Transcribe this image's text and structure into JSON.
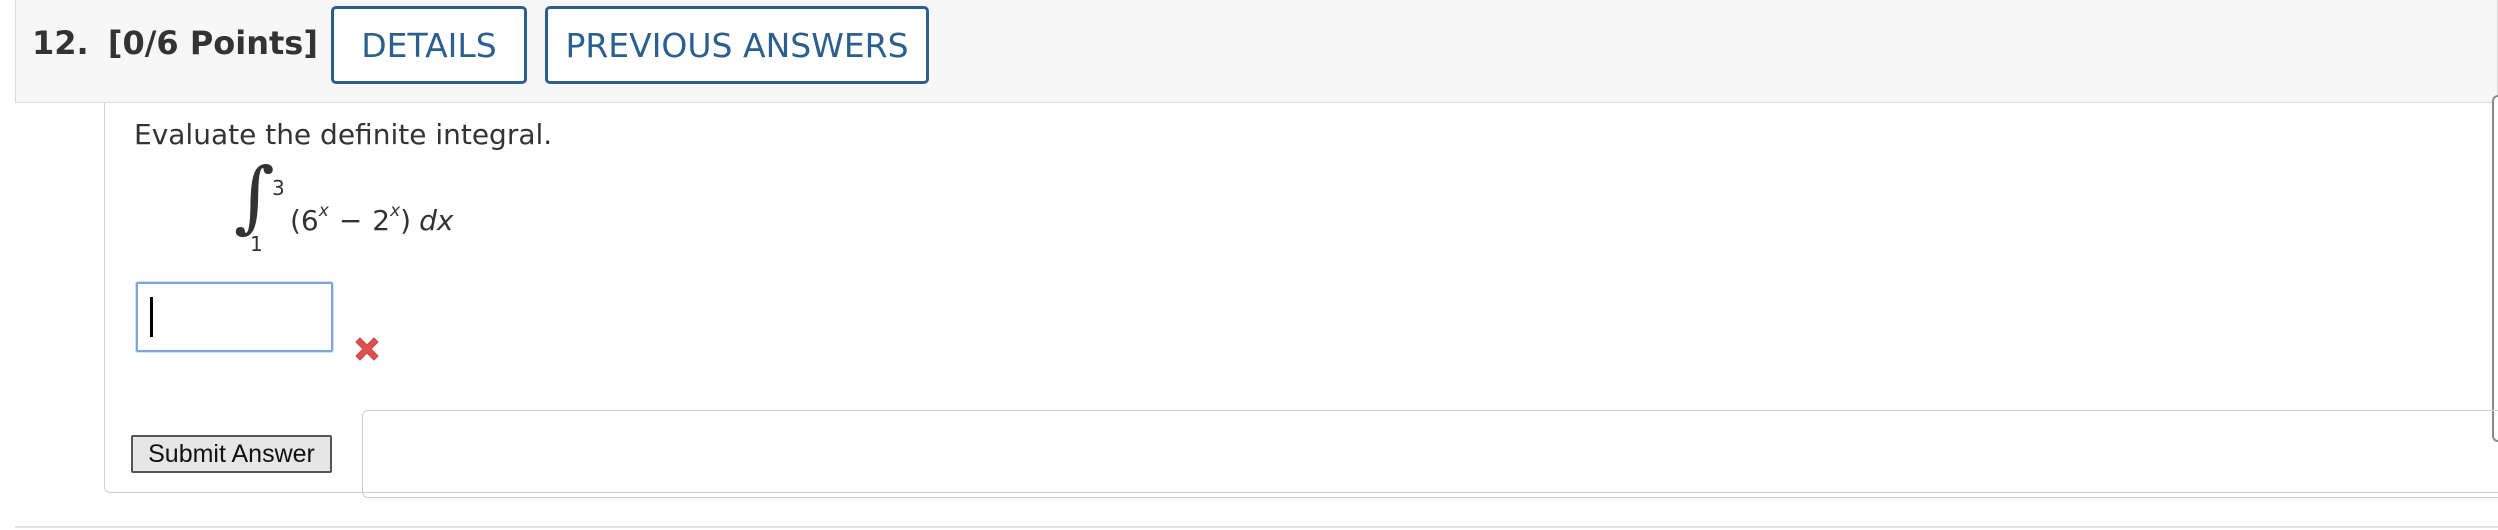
{
  "question": {
    "number_label": "12.",
    "points_label": "[0/6 Points]"
  },
  "header_buttons": {
    "details_label": "DETAILS",
    "previous_answers_label": "PREVIOUS ANSWERS"
  },
  "problem": {
    "prompt": "Evaluate the definite integral.",
    "integral": {
      "upper_limit": "3",
      "lower_limit": "1",
      "open_paren": "(6",
      "exp1": "x",
      "operator": "−",
      "term2": "2",
      "exp2": "x",
      "close_paren": ")",
      "differential": "dx"
    }
  },
  "answer": {
    "value": "",
    "status": "incorrect"
  },
  "actions": {
    "submit_label": "Submit Answer"
  },
  "colors": {
    "accent_blue": "#2b5f8e",
    "incorrect_red": "#e0504f",
    "header_bg": "#f7f7f7"
  },
  "icons": {
    "incorrect": "x-mark-icon"
  }
}
